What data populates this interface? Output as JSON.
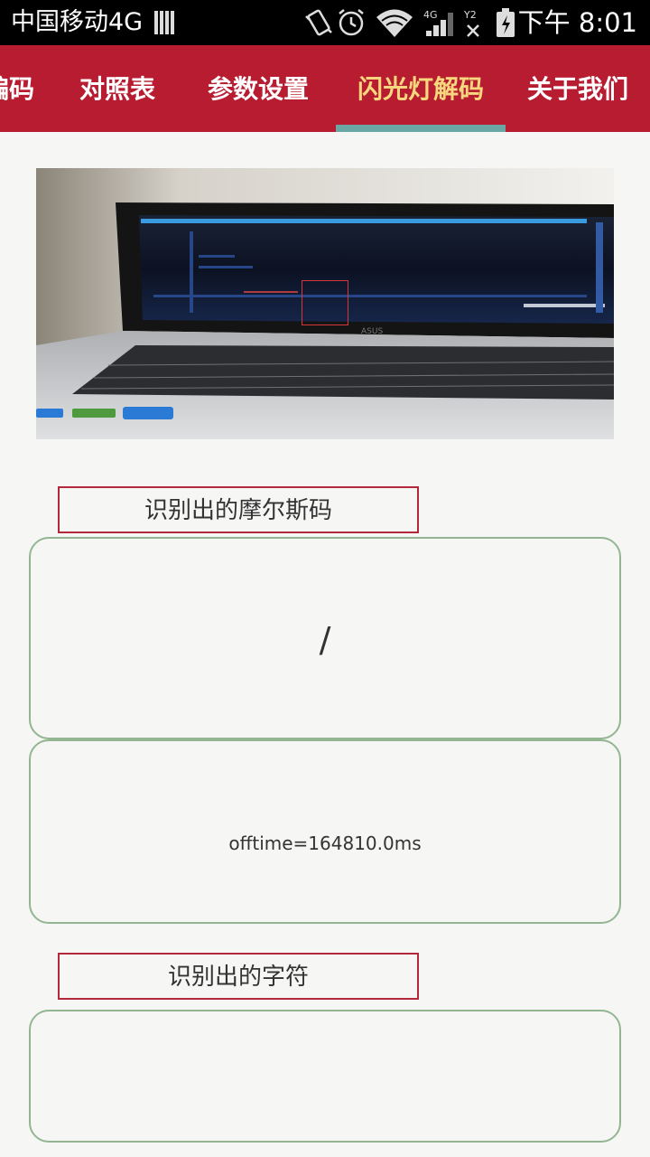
{
  "status_bar": {
    "carrier": "中国移动4G",
    "network_4g": "4G",
    "sim2_label": "Y2",
    "time": "下午 8:01",
    "icons": [
      "sim-bars-icon",
      "vibrate-icon",
      "alarm-icon",
      "wifi-icon",
      "signal-icon",
      "no-signal-icon",
      "battery-icon"
    ]
  },
  "tabs": [
    {
      "label": "编码",
      "active": false
    },
    {
      "label": "对照表",
      "active": false
    },
    {
      "label": "参数设置",
      "active": false
    },
    {
      "label": "闪光灯解码",
      "active": true
    },
    {
      "label": "关于我们",
      "active": false
    }
  ],
  "colors": {
    "tab_bar": "#b81c31",
    "tab_active_text": "#f6d77d",
    "tab_indicator": "#6aa6a3",
    "label_border": "#b3283a",
    "panel_border": "#93b592",
    "background": "#f6f7f5"
  },
  "camera_preview": {
    "description_icon": "camera-preview",
    "brand_on_screen": "ASUS"
  },
  "morse_section": {
    "label": "识别出的摩尔斯码",
    "value": "/",
    "offtime": "offtime=164810.0ms"
  },
  "char_section": {
    "label": "识别出的字符",
    "value": ""
  }
}
